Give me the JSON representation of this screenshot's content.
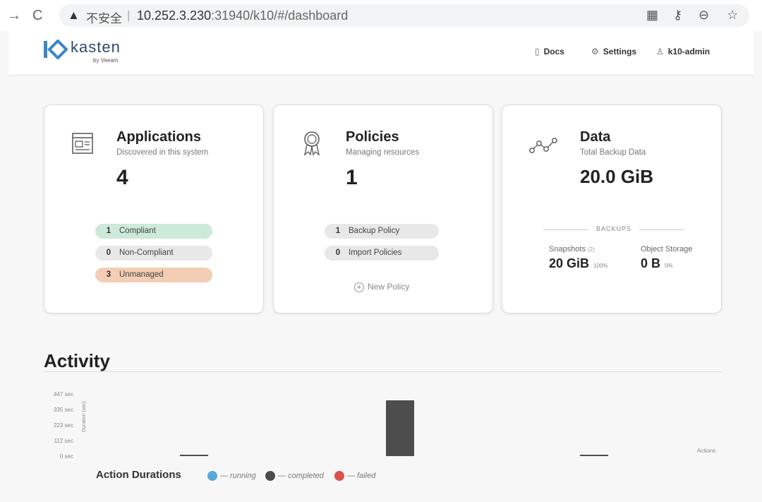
{
  "browser": {
    "back_icon": "arrow-right-icon",
    "warning_glyph": "▲",
    "insecure_label": "不安全",
    "url_host": "10.252.3.230",
    "url_rest": ":31940/k10/#/dashboard"
  },
  "header": {
    "logo_text": "kasten",
    "logo_sub": "by Veeam",
    "links": {
      "docs": "Docs",
      "settings": "Settings",
      "user": "k10-admin"
    }
  },
  "cards": {
    "applications": {
      "title": "Applications",
      "subtitle": "Discovered in this system",
      "value": "4",
      "pills": [
        {
          "count": "1",
          "label": "Compliant"
        },
        {
          "count": "0",
          "label": "Non-Compliant"
        },
        {
          "count": "3",
          "label": "Unmanaged"
        }
      ]
    },
    "policies": {
      "title": "Policies",
      "subtitle": "Managing resources",
      "value": "1",
      "pills": [
        {
          "count": "1",
          "label": "Backup Policy"
        },
        {
          "count": "0",
          "label": "Import Policies"
        }
      ],
      "new_policy": "New Policy"
    },
    "data": {
      "title": "Data",
      "subtitle": "Total Backup Data",
      "value": "20.0 GiB",
      "backups_label": "BACKUPS",
      "snapshots_label": "Snapshots",
      "snapshots_count": "(2)",
      "snapshots_value": "20 GiB",
      "snapshots_pct": "100%",
      "object_label": "Object Storage",
      "object_value": "0 B",
      "object_pct": "0%"
    }
  },
  "activity": {
    "title": "Activity",
    "legend_title": "Action Durations",
    "legend": [
      {
        "label": "— running",
        "color": "#5aa9d6"
      },
      {
        "label": "— completed",
        "color": "#4d4d4d"
      },
      {
        "label": "— failed",
        "color": "#d9534f"
      }
    ]
  },
  "chart_data": {
    "type": "bar",
    "ylabel": "Duration (sec)",
    "xlabel": "Actions",
    "y_ticks": [
      "447 sec",
      "335 sec",
      "223 sec",
      "112 sec",
      "0 sec"
    ],
    "ylim": [
      0,
      447
    ],
    "series": [
      {
        "name": "completed",
        "color": "#4d4d4d",
        "values": [
          10,
          400,
          10
        ]
      }
    ],
    "x_positions": [
      0.18,
      0.52,
      0.84
    ]
  }
}
